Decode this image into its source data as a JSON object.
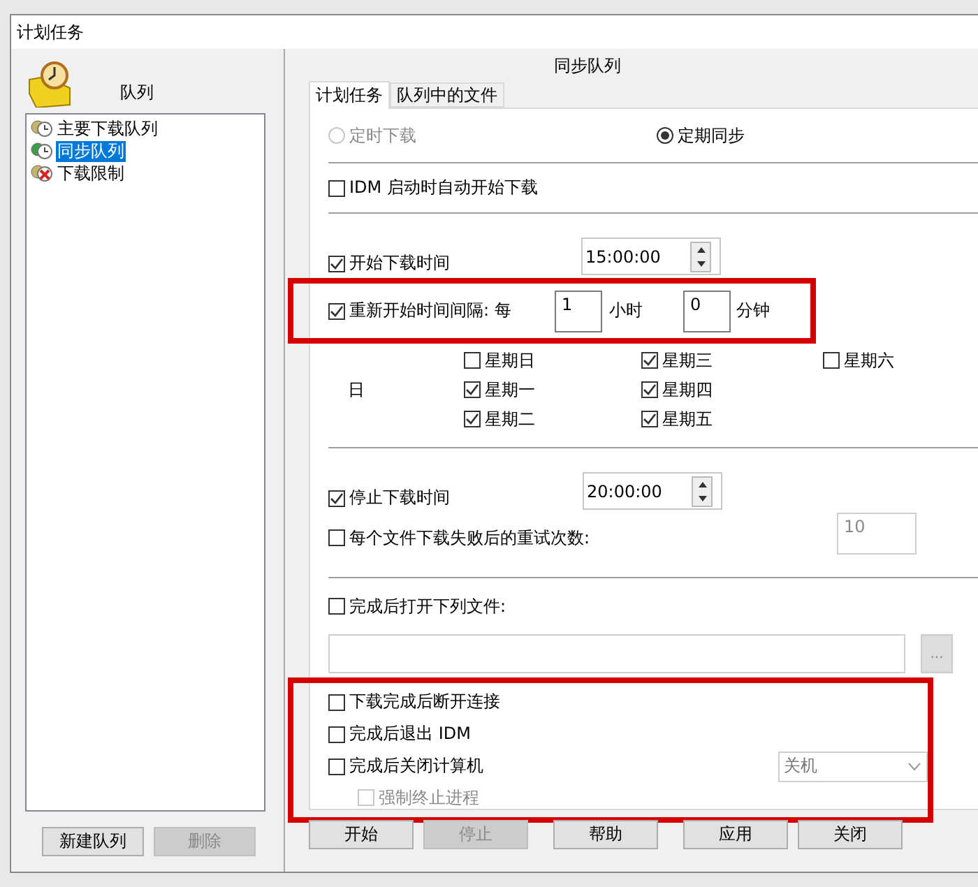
{
  "window": {
    "title": "计划任务"
  },
  "queues": {
    "label": "队列",
    "items": [
      {
        "label": "主要下载队列",
        "selected": false,
        "kind": "clock"
      },
      {
        "label": "同步队列",
        "selected": true,
        "kind": "sync"
      },
      {
        "label": "下载限制",
        "selected": false,
        "kind": "limit"
      }
    ]
  },
  "queue_buttons": [
    {
      "label": "新建队列",
      "disabled": false
    },
    {
      "label": "删除",
      "disabled": true
    }
  ],
  "heading": "同步队列",
  "tabs": [
    {
      "label": "计划任务",
      "selected": true
    },
    {
      "label": "队列中的文件",
      "selected": false
    }
  ],
  "mode_options": [
    {
      "label": "定时下载",
      "selected": false,
      "disabled": true
    },
    {
      "label": "定期同步",
      "selected": true,
      "disabled": false
    }
  ],
  "start_on_idm": {
    "label": "IDM 启动时自动开始下载",
    "checked": false
  },
  "start_time": {
    "label": "开始下载时间",
    "checked": true,
    "value": "15:00:00"
  },
  "restart": {
    "label": "重新开始时间间隔: 每",
    "checked": true,
    "hours": "1",
    "hours_unit": "小时",
    "minutes": "0",
    "minutes_unit": "分钟",
    "highlighted": true
  },
  "days_label": "日",
  "weekdays": [
    {
      "label": "星期日",
      "checked": false
    },
    {
      "label": "星期一",
      "checked": true
    },
    {
      "label": "星期二",
      "checked": true
    },
    {
      "label": "星期三",
      "checked": true
    },
    {
      "label": "星期四",
      "checked": true
    },
    {
      "label": "星期五",
      "checked": true
    },
    {
      "label": "星期六",
      "checked": false
    }
  ],
  "stop_time": {
    "label": "停止下载时间",
    "checked": true,
    "value": "20:00:00"
  },
  "retry": {
    "label": "每个文件下载失败后的重试次数:",
    "checked": false,
    "value": "10"
  },
  "open_file": {
    "label": "完成后打开下列文件:",
    "checked": false,
    "browse": "..."
  },
  "after_done": {
    "highlighted": true,
    "options": [
      {
        "label": "下载完成后断开连接",
        "checked": false,
        "disabled": false
      },
      {
        "label": "完成后退出 IDM",
        "checked": false,
        "disabled": false
      },
      {
        "label": "完成后关闭计算机",
        "checked": false,
        "disabled": false,
        "action": "关机",
        "children": [
          {
            "label": "强制终止进程",
            "checked": false,
            "disabled": true
          }
        ]
      }
    ]
  },
  "buttons": [
    {
      "label": "开始",
      "disabled": false
    },
    {
      "label": "停止",
      "disabled": true
    },
    {
      "label": "帮助",
      "disabled": false
    },
    {
      "label": "应用",
      "disabled": false
    },
    {
      "label": "关闭",
      "disabled": false
    }
  ]
}
